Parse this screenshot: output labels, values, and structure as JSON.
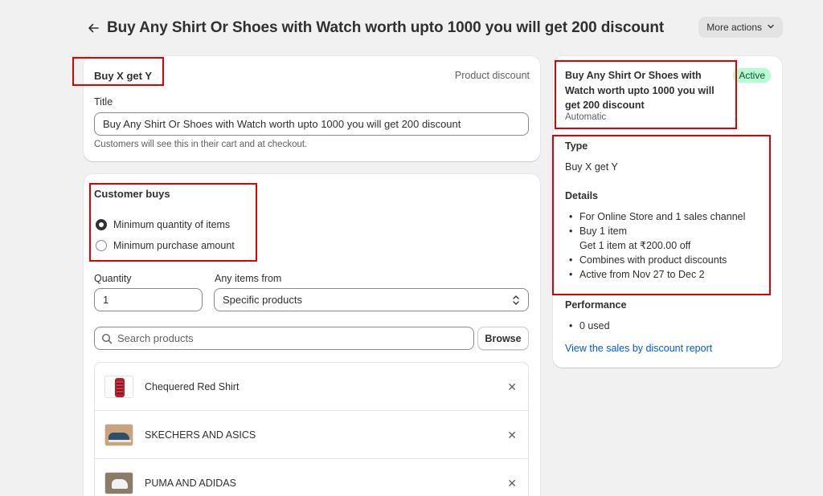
{
  "header": {
    "title": "Buy Any Shirt Or Shoes with Watch worth upto 1000 you will get 200 discount",
    "more_actions": "More actions"
  },
  "summary_card": {
    "method": "Buy X get Y",
    "kind": "Product discount",
    "title_label": "Title",
    "title_value": "Buy Any Shirt Or Shoes with Watch worth upto 1000 you will get 200 discount",
    "help": "Customers will see this in their cart and at checkout."
  },
  "customer_buys": {
    "heading": "Customer buys",
    "options": [
      "Minimum quantity of items",
      "Minimum purchase amount"
    ],
    "selected_index": 0,
    "quantity_label": "Quantity",
    "quantity_value": "1",
    "items_from_label": "Any items from",
    "items_from_value": "Specific products",
    "search_placeholder": "Search products",
    "browse": "Browse",
    "products": [
      {
        "name": "Chequered Red Shirt"
      },
      {
        "name": "SKECHERS AND ASICS"
      },
      {
        "name": "PUMA AND ADIDAS"
      }
    ]
  },
  "sidebar": {
    "title": "Buy Any Shirt Or Shoes with Watch worth upto 1000 you will get 200 discount",
    "subtitle": "Automatic",
    "status": "Active",
    "type_heading": "Type",
    "type_value": "Buy X get Y",
    "details_heading": "Details",
    "details": [
      "For Online Store and 1 sales channel",
      "Buy 1 item",
      "Get 1 item at ₹200.00 off",
      "Combines with product discounts",
      "Active from Nov 27 to Dec 2"
    ],
    "performance_heading": "Performance",
    "performance": [
      "0 used"
    ],
    "report_link": "View the sales by discount report"
  },
  "colors": {
    "highlight": "#e00000",
    "active_badge_bg": "#b4fed2",
    "link": "#005bd3"
  }
}
